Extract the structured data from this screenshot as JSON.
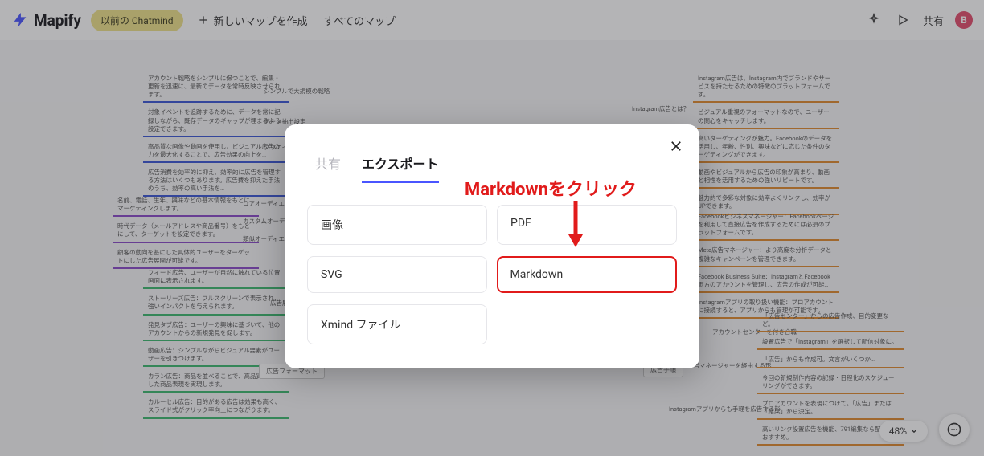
{
  "header": {
    "logo_text": "Mapify",
    "pill_label": "以前の Chatmind",
    "new_map_label": "新しいマップを作成",
    "all_maps_label": "すべてのマップ",
    "share_label": "共有",
    "avatar_initial": "B"
  },
  "modal": {
    "tab_share": "共有",
    "tab_export": "エクスポート",
    "options": {
      "image": "画像",
      "pdf": "PDF",
      "svg": "SVG",
      "markdown": "Markdown",
      "xmind": "Xmind ファイル"
    }
  },
  "annotation": {
    "text": "Markdownをクリック"
  },
  "zoom": {
    "label": "48%"
  },
  "map": {
    "left_blue": [
      "アカウント戦略をシンプルに保つことで、編集・更新を迅速に、最新のデータを常時反映させられます。",
      "対象イベントを追跡するために、データを常に記録しながら、既存データのギャップが埋まるよう設定できます。",
      "高品質な画像や動画を使用し、ビジュアル広告の力を最大化することで、広告効果の向上を…",
      "広告消費を効率的に抑え、効率的に広告を管理する方法はいくつもあります。広告費を抑えた手法のうち、効率の高い手法を…",
      "シンプルで大規模の戦略",
      "データ抽出設定",
      "クリエイティブな…"
    ],
    "left_purple": [
      "名前、電話、生年、興味などの基本情報をもとにマーケティングします。",
      "時代データ（メールアドレスや商品番号）をもとにして、ターゲットを設定できます。",
      "顧客の動向を基にした具体的ユーザーをターゲットにした広告展開が可能です。",
      "コアオーディエンス",
      "カスタムオーディエンス",
      "類似オーディエンス"
    ],
    "left_green": [
      "フィード広告、ユーザーが自然に触れている位置画面に表示されます。",
      "ストーリーズ広告：フルスクリーンで表示され、強いインパクトを与えられます。",
      "発見タブ広告：ユーザーの興味に基づいて、他のアカウントからの新規発見を促します。",
      "動画広告：シンプルながらビジュアル要素がユーザーを引きつけます。",
      "カラン広告：商品を並べることで、高品質な一貫した商品表現を実現します。",
      "カルーセル広告：目的がある広告は効果も高く、スライド式がクリック率向上につながります。"
    ],
    "left_green_label": "広告展開の方法",
    "left_right_label": "広告フォーマット",
    "right_orange_top": [
      "Instagram広告は、Instagram内でブランドやサービスを持たせるための特徴のプラットフォームです。",
      "ビジュアル重視のフォーマットなので、ユーザーの関心をキャッチします。",
      "高いターゲティングが魅力。Facebookのデータを活用し、年齢、性別、興味などに応じた条件のターゲティングができます。",
      "動画やビジュアルから広告の印象が高まり、動画と相性を活用するための強いリピートです。",
      "魅力的で多彩な対象に効率よくリンクし、効率がUPできます。"
    ],
    "right_orange_top_label": "Instagram広告とは？",
    "right_orange_mid": [
      "Facebookビジネスマネージャー：Facebookページを利用して直接広告を作成するためには必須のプラットフォームです。",
      "Meta広告マネージャー：より高度な分析データと複雑なキャンペーンを管理できます。",
      "Facebook Business Suite：InstagramとFacebook両方のアカウントを管理し、広告の作成が可能…",
      "Instagramアプリの取り扱い機能：プロアカウントに接続すると、アプリからも管理が可能です。"
    ],
    "right_orange_bot_label": "Meta広告マネージャーを経由する形",
    "right_orange_bot": [
      "「広告センター」からの広告作成、目的変更など。",
      "設置広告で「Instagram」を選択して配信対象に。",
      "「広告」からも作成可。文言がいくつか…",
      "今回の新規制作内容の記録・日程化のスケジューリングができます。",
      "プロアカウントを表現につけて。「広告」または「結果」から決定。",
      "高いリンク設置広告を機能、791編集なら配置をおすすめ。"
    ],
    "right_orange_bottom_label": "Instagramアプリからも手軽を広告する形",
    "middle_label": "広告手順",
    "center_top_label": "アカウントセンターを付き合職"
  }
}
